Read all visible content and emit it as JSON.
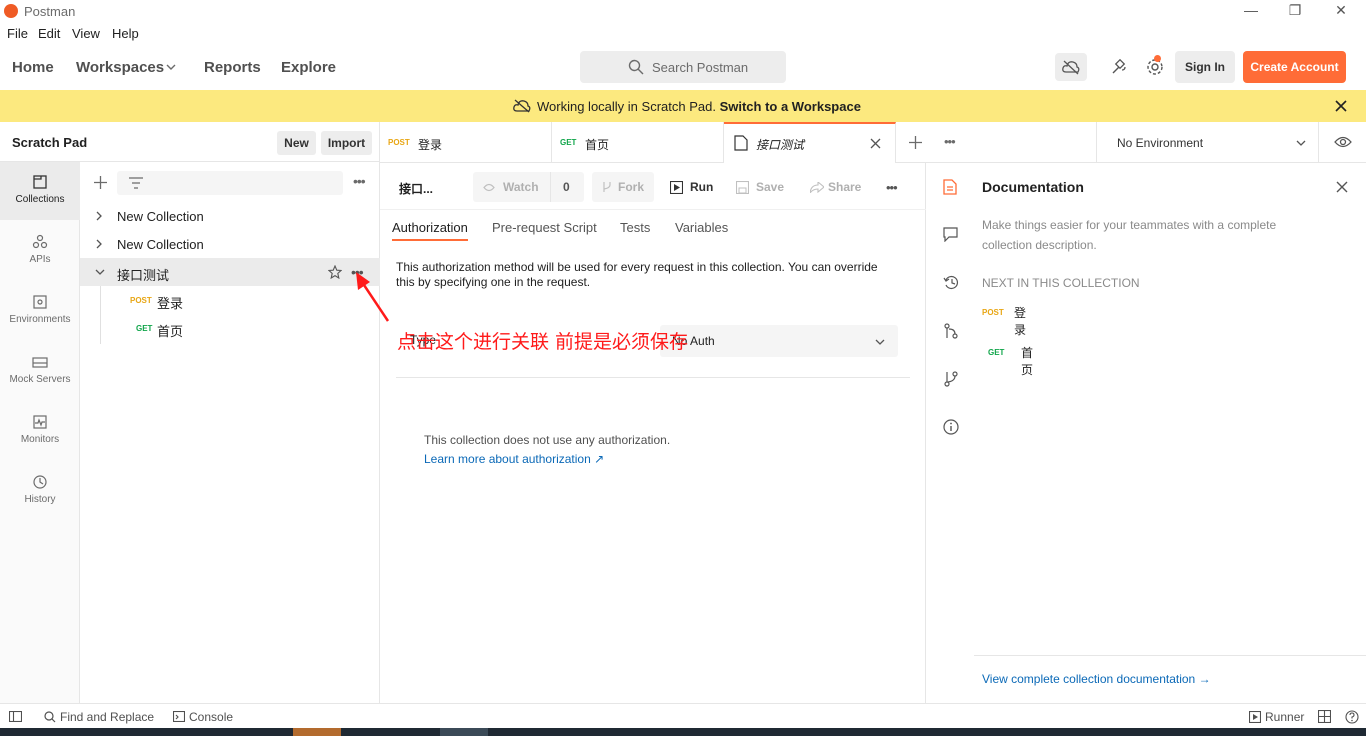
{
  "window": {
    "title": "Postman"
  },
  "menu": [
    "File",
    "Edit",
    "View",
    "Help"
  ],
  "nav": {
    "home": "Home",
    "workspaces": "Workspaces",
    "reports": "Reports",
    "explore": "Explore",
    "search_placeholder": "Search Postman",
    "sign_in": "Sign In",
    "create_account": "Create Account"
  },
  "banner": {
    "text": "Working locally in Scratch Pad.",
    "link": "Switch to a Workspace"
  },
  "scratch": {
    "title": "Scratch Pad",
    "new": "New",
    "import": "Import"
  },
  "rail": [
    {
      "label": "Collections",
      "icon": "collections-icon"
    },
    {
      "label": "APIs",
      "icon": "apis-icon"
    },
    {
      "label": "Environments",
      "icon": "environments-icon"
    },
    {
      "label": "Mock Servers",
      "icon": "mock-servers-icon"
    },
    {
      "label": "Monitors",
      "icon": "monitors-icon"
    },
    {
      "label": "History",
      "icon": "history-icon"
    }
  ],
  "tree": {
    "collections": [
      "New Collection",
      "New Collection",
      "接口测试"
    ],
    "requests": [
      {
        "method": "POST",
        "name": "登录"
      },
      {
        "method": "GET",
        "name": "首页"
      }
    ]
  },
  "tabs": [
    {
      "method": "POST",
      "name": "登录"
    },
    {
      "method": "GET",
      "name": "首页"
    },
    {
      "method": "",
      "name": "接口测试"
    }
  ],
  "environment": "No Environment",
  "request": {
    "name": "接口...",
    "watch": "Watch",
    "watch_count": "0",
    "fork": "Fork",
    "run": "Run",
    "save": "Save",
    "share": "Share"
  },
  "subtabs": [
    "Authorization",
    "Pre-request Script",
    "Tests",
    "Variables"
  ],
  "auth": {
    "description": "This authorization method will be used for every request in this collection. You can override this by specifying one in the request.",
    "type_label": "Type",
    "type_value": "No Auth",
    "none_text": "This collection does not use any authorization.",
    "learn_more": "Learn more about authorization ↗"
  },
  "annotation": "点击这个进行关联  前提是必须保存",
  "doc": {
    "title": "Documentation",
    "description": "Make things easier for your teammates with a complete collection description.",
    "next_heading": "NEXT IN THIS COLLECTION",
    "next": [
      {
        "method": "POST",
        "name": "登录"
      },
      {
        "method": "GET",
        "name": "首页"
      }
    ],
    "view_link": "View complete collection documentation →"
  },
  "status": {
    "find": "Find and Replace",
    "console": "Console",
    "runner": "Runner"
  },
  "colors": {
    "accent": "#ff6c37",
    "banner": "#fce97f",
    "post": "#e8a614",
    "get": "#10a54a",
    "link": "#0b69b7",
    "annotation": "#ff1a1a"
  }
}
